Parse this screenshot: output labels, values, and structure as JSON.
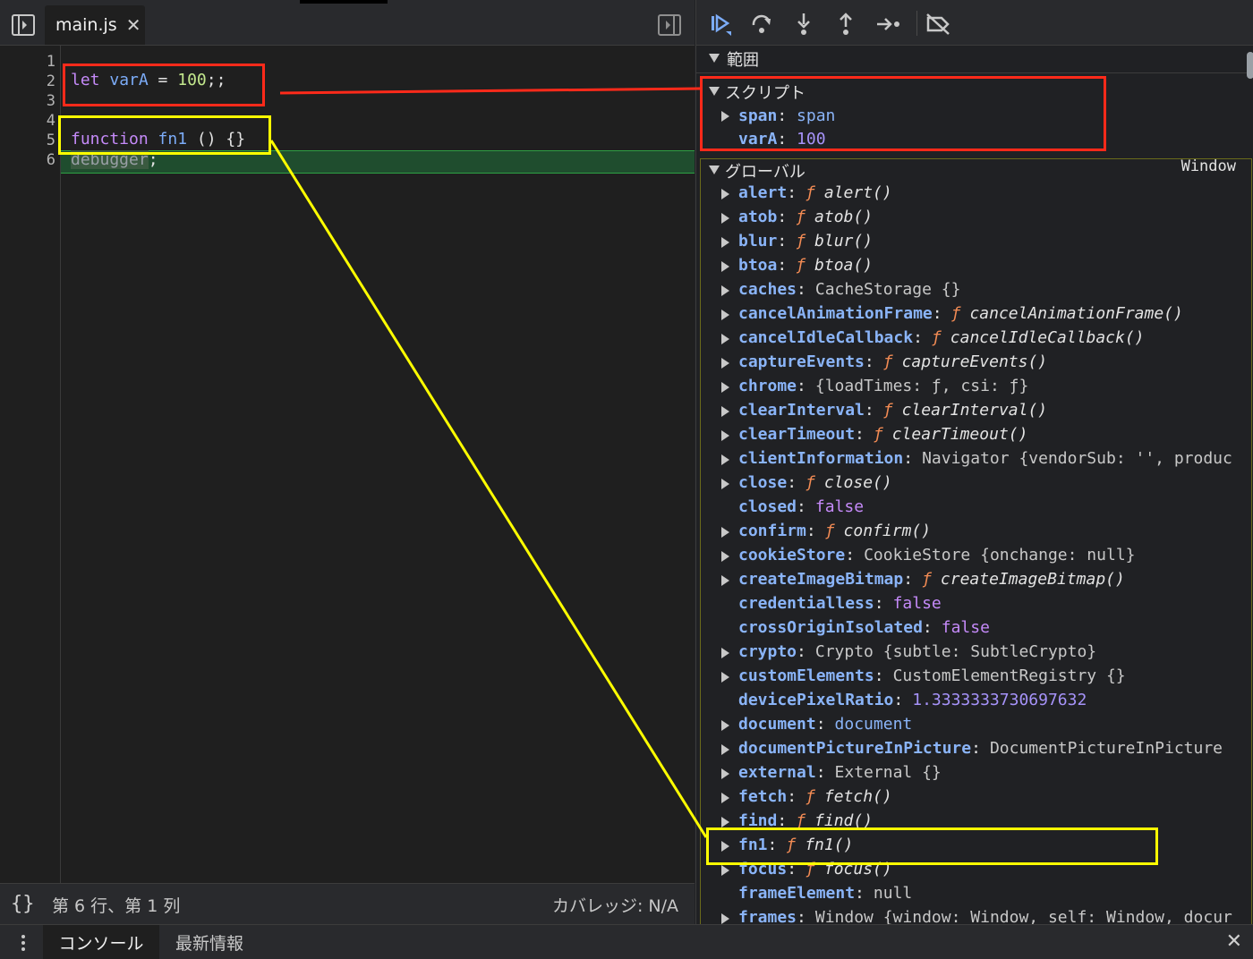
{
  "editor": {
    "tab_label": "main.js",
    "tab_close": "✕",
    "line_numbers": [
      "1",
      "2",
      "3",
      "4",
      "5",
      "6"
    ],
    "line2": {
      "kw": "let",
      "name": "varA",
      "op": " = ",
      "num": "100",
      "tail": ";;"
    },
    "line5": {
      "kw": "function",
      "name": "fn1",
      "tail": " () {}"
    },
    "line6": {
      "text": "debugger",
      "tail": ";"
    }
  },
  "status_bar": {
    "pretty_print": "{}",
    "cursor_position": "第 6 行、第 1 列",
    "coverage": "カバレッジ: N/A"
  },
  "scope": {
    "header": "範囲",
    "script_section": {
      "title": "スクリプト",
      "props": [
        {
          "key": "span",
          "value": "span"
        },
        {
          "key": "varA",
          "value": "100"
        }
      ]
    },
    "global_section": {
      "title": "グローバル",
      "badge": "Window",
      "props": [
        {
          "key": "alert",
          "fname": "alert()"
        },
        {
          "key": "atob",
          "fname": "atob()"
        },
        {
          "key": "blur",
          "fname": "blur()"
        },
        {
          "key": "btoa",
          "fname": "btoa()"
        },
        {
          "key": "caches",
          "value": "CacheStorage {}"
        },
        {
          "key": "cancelAnimationFrame",
          "fname": "cancelAnimationFrame()"
        },
        {
          "key": "cancelIdleCallback",
          "fname": "cancelIdleCallback()"
        },
        {
          "key": "captureEvents",
          "fname": "captureEvents()"
        },
        {
          "key": "chrome",
          "value": "{loadTimes: ƒ, csi: ƒ}"
        },
        {
          "key": "clearInterval",
          "fname": "clearInterval()"
        },
        {
          "key": "clearTimeout",
          "fname": "clearTimeout()"
        },
        {
          "key": "clientInformation",
          "value": "Navigator {vendorSub: '', produc"
        },
        {
          "key": "close",
          "fname": "close()"
        },
        {
          "key": "closed",
          "value": "false"
        },
        {
          "key": "confirm",
          "fname": "confirm()"
        },
        {
          "key": "cookieStore",
          "value": "CookieStore {onchange: null}"
        },
        {
          "key": "createImageBitmap",
          "fname": "createImageBitmap()"
        },
        {
          "key": "credentialless",
          "value": "false"
        },
        {
          "key": "crossOriginIsolated",
          "value": "false"
        },
        {
          "key": "crypto",
          "value": "Crypto {subtle: SubtleCrypto}"
        },
        {
          "key": "customElements",
          "value": "CustomElementRegistry {}"
        },
        {
          "key": "devicePixelRatio",
          "value": "1.3333333730697632"
        },
        {
          "key": "document",
          "value": "document"
        },
        {
          "key": "documentPictureInPicture",
          "value": "DocumentPictureInPicture"
        },
        {
          "key": "external",
          "value": "External {}"
        },
        {
          "key": "fetch",
          "fname": "fetch()"
        },
        {
          "key": "find",
          "fname": "find()"
        },
        {
          "key": "fn1",
          "fname": "fn1()"
        },
        {
          "key": "focus",
          "fname": "focus()"
        },
        {
          "key": "frameElement",
          "value": "null"
        },
        {
          "key": "frames",
          "value": "Window {window: Window, self: Window, docur"
        }
      ]
    }
  },
  "drawer": {
    "tabs": [
      "コンソール",
      "最新情報"
    ],
    "close": "✕"
  },
  "colors": {
    "annotation_red": "#ff2a1a",
    "annotation_yellow": "#ffff00",
    "paused_line": "#1f4d2e"
  }
}
